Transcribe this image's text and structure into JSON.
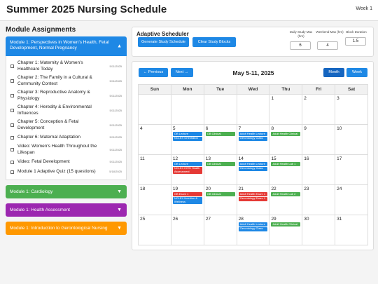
{
  "header": {
    "title": "Summer 2025 Nursing Schedule",
    "week": "Week 1"
  },
  "colors": {
    "blue": "#1e88e5",
    "green": "#4caf50",
    "purple": "#9c27b0",
    "orange": "#ff9800",
    "red": "#e53935"
  },
  "modules": {
    "title": "Module Assignments",
    "expanded": {
      "title": "Module 1: Perspectives in Women's Health, Fetal Development, Normal Pregnancy",
      "items": [
        {
          "text": "Chapter 1: Maternity & Women's Healthcare Today",
          "date": "5/11/2025"
        },
        {
          "text": "Chapter 2: The Family in a Cultural & Community Context",
          "date": "5/11/2025"
        },
        {
          "text": "Chapter 3: Reproductive Anatomy & Physiology",
          "date": "5/11/2025"
        },
        {
          "text": "Chapter 4: Heredity & Environmental Influences",
          "date": "5/11/2025"
        },
        {
          "text": "Chapter 5: Conception & Fetal Development",
          "date": "5/11/2025"
        },
        {
          "text": "Chapter 6: Maternal Adaptation",
          "date": "5/11/2025"
        },
        {
          "text": "Video: Women's Health Throughout the Lifespan",
          "date": "5/11/2025"
        },
        {
          "text": "Video: Fetal Development",
          "date": "5/11/2025"
        },
        {
          "text": "Module 1 Adaptive Quiz (15 questions)",
          "date": "5/18/2025"
        }
      ]
    },
    "collapsed": [
      {
        "title": "Module 1: Cardiology",
        "color": "#4caf50"
      },
      {
        "title": "Module 1: Health Assessment",
        "color": "#9c27b0"
      },
      {
        "title": "Module 1: Introduction to Gerontological Nursing",
        "color": "#ff9800"
      }
    ]
  },
  "scheduler": {
    "title": "Adaptive Scheduler",
    "generate_label": "Generate Study Schedule",
    "clear_label": "Clear Study Blocks",
    "fields": [
      {
        "label": "Daily Study Max (hrs)",
        "value": "6"
      },
      {
        "label": "Weekend Max (hrs)",
        "value": "4"
      },
      {
        "label": "Block Duration",
        "value": "1.5"
      }
    ]
  },
  "calendar": {
    "prev_label": "← Previous",
    "next_label": "Next →",
    "title": "May 5-11, 2025",
    "month_label": "Month",
    "week_label": "Week",
    "days": [
      "Sun",
      "Mon",
      "Tue",
      "Wed",
      "Thu",
      "Fri",
      "Sat"
    ],
    "weeks": [
      [
        {
          "day": ""
        },
        {
          "day": ""
        },
        {
          "day": ""
        },
        {
          "day": ""
        },
        {
          "day": "1"
        },
        {
          "day": "2"
        },
        {
          "day": "3"
        }
      ],
      [
        {
          "day": "4"
        },
        {
          "day": "5",
          "events": [
            {
              "label": "OB Lecture",
              "color": "#1e88e5"
            },
            {
              "label": "NCLEX Orientation",
              "color": "#1e88e5"
            }
          ]
        },
        {
          "day": "6",
          "events": [
            {
              "label": "OB Clinical",
              "color": "#4caf50"
            }
          ]
        },
        {
          "day": "7",
          "events": [
            {
              "label": "Adult Health Lecture",
              "color": "#1e88e5"
            },
            {
              "label": "Gerontology Class",
              "color": "#1e88e5"
            }
          ]
        },
        {
          "day": "8",
          "events": [
            {
              "label": "Adult Health Clinical",
              "color": "#4caf50"
            }
          ]
        },
        {
          "day": "9"
        },
        {
          "day": "10"
        }
      ],
      [
        {
          "day": "11"
        },
        {
          "day": "12",
          "events": [
            {
              "label": "OB Lecture",
              "color": "#1e88e5"
            },
            {
              "label": "NCLEX HESI Health Assessment",
              "color": "#e53935"
            }
          ]
        },
        {
          "day": "13",
          "events": [
            {
              "label": "OB Clinical",
              "color": "#4caf50"
            }
          ]
        },
        {
          "day": "14",
          "events": [
            {
              "label": "Adult Health Lecture",
              "color": "#1e88e5"
            },
            {
              "label": "Gerontology Class",
              "color": "#1e88e5"
            }
          ]
        },
        {
          "day": "15",
          "events": [
            {
              "label": "Adult Health Lab 1",
              "color": "#4caf50"
            }
          ]
        },
        {
          "day": "16"
        },
        {
          "day": "17"
        }
      ],
      [
        {
          "day": "18"
        },
        {
          "day": "19",
          "events": [
            {
              "label": "OB Exam 1",
              "color": "#e53935"
            },
            {
              "label": "NCLEX Nutrition & Wellness",
              "color": "#1e88e5"
            }
          ]
        },
        {
          "day": "20",
          "events": [
            {
              "label": "OB Clinical",
              "color": "#4caf50"
            }
          ]
        },
        {
          "day": "21",
          "events": [
            {
              "label": "Adult Health Exam 1",
              "color": "#e53935"
            },
            {
              "label": "Gerontology Exam 1",
              "color": "#e53935"
            }
          ]
        },
        {
          "day": "22",
          "events": [
            {
              "label": "Adult Health Lab 2",
              "color": "#4caf50"
            }
          ]
        },
        {
          "day": "23"
        },
        {
          "day": "24"
        }
      ],
      [
        {
          "day": "25"
        },
        {
          "day": "26"
        },
        {
          "day": "27"
        },
        {
          "day": "28",
          "events": [
            {
              "label": "Adult Health Lecture",
              "color": "#1e88e5"
            },
            {
              "label": "Gerontology Class",
              "color": "#1e88e5"
            }
          ]
        },
        {
          "day": "29",
          "events": [
            {
              "label": "Adult Health Clinical",
              "color": "#4caf50"
            }
          ]
        },
        {
          "day": "30"
        },
        {
          "day": "31"
        }
      ]
    ]
  }
}
